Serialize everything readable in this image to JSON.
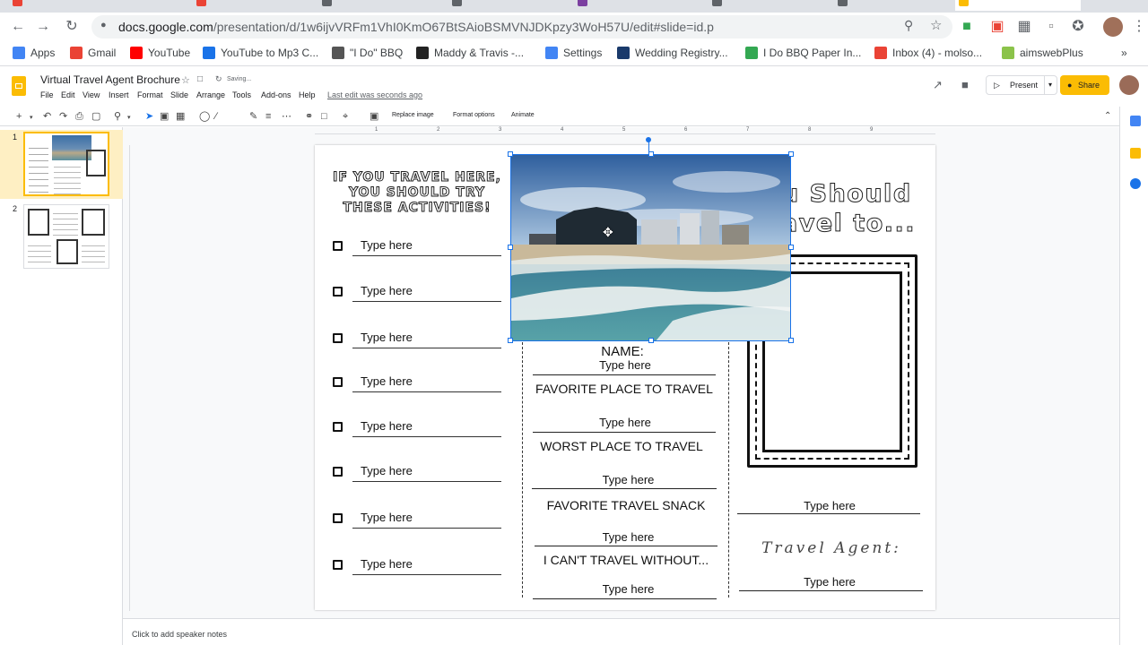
{
  "browser": {
    "url_host": "docs.google.com",
    "url_path": "/presentation/d/1w6ijvVRFm1VhI0KmO67BtSAioBSMVNJDKpzy3WoH57U/edit#slide=id.p"
  },
  "bookmarks": [
    {
      "label": "Apps",
      "icon": "apps-grid-icon",
      "color": "#4285f4"
    },
    {
      "label": "Gmail",
      "icon": "gmail-icon",
      "color": "#ea4335"
    },
    {
      "label": "YouTube",
      "icon": "youtube-icon",
      "color": "#ff0000"
    },
    {
      "label": "YouTube to Mp3 C...",
      "icon": "cloud-icon",
      "color": "#1a73e8"
    },
    {
      "label": "\"I Do\" BBQ",
      "icon": "bbq-icon",
      "color": "#555555"
    },
    {
      "label": "Maddy & Travis -...",
      "icon": "wedding-icon",
      "color": "#222222"
    },
    {
      "label": "Settings",
      "icon": "google-icon",
      "color": "#4285f4"
    },
    {
      "label": "Wedding Registry...",
      "icon": "registry-icon",
      "color": "#1a3a6b"
    },
    {
      "label": "I Do BBQ Paper In...",
      "icon": "paper-icon",
      "color": "#33a852"
    },
    {
      "label": "Inbox (4) - molso...",
      "icon": "gmail-icon",
      "color": "#ea4335"
    },
    {
      "label": "aimswebPlus",
      "icon": "aimsweb-icon",
      "color": "#8bc34a"
    }
  ],
  "app": {
    "doc_title": "Virtual Travel Agent Brochure",
    "saving": "Saving...",
    "menus": [
      "File",
      "Edit",
      "View",
      "Insert",
      "Format",
      "Slide",
      "Arrange",
      "Tools",
      "Add-ons",
      "Help"
    ],
    "last_edit": "Last edit was seconds ago",
    "present_label": "Present",
    "share_label": "Share"
  },
  "toolbar": {
    "replace_image": "Replace image",
    "format_options": "Format options",
    "animate": "Animate"
  },
  "filmstrip": {
    "slides": [
      "1",
      "2"
    ]
  },
  "slide": {
    "left_title": "IF YOU TRAVEL HERE, YOU SHOULD TRY THESE ACTIVITIES!",
    "right_title_1": "u Should",
    "right_title_2": "avel to...",
    "activities": [
      "Type here",
      "Type here",
      "Type here",
      "Type here",
      "Type here",
      "Type here",
      "Type here",
      "Type here"
    ],
    "name_label": "NAME:",
    "name_value": "Type here",
    "fav_place_label": "FAVORITE PLACE TO TRAVEL",
    "fav_place_value": "Type here",
    "worst_place_label": "WORST PLACE TO TRAVEL",
    "worst_place_value": "Type here",
    "snack_label": "FAVORITE TRAVEL SNACK",
    "snack_value": "Type here",
    "cant_travel_label": "I CAN'T TRAVEL WITHOUT...",
    "cant_travel_value": "Type here",
    "right_value_1": "Type here",
    "travel_agent_label": "Travel Agent:",
    "right_value_2": "Type here"
  },
  "notes": {
    "placeholder": "Click to add speaker notes"
  },
  "ruler_numbers": [
    "1",
    "2",
    "3",
    "4",
    "5",
    "6",
    "7",
    "8",
    "9"
  ]
}
